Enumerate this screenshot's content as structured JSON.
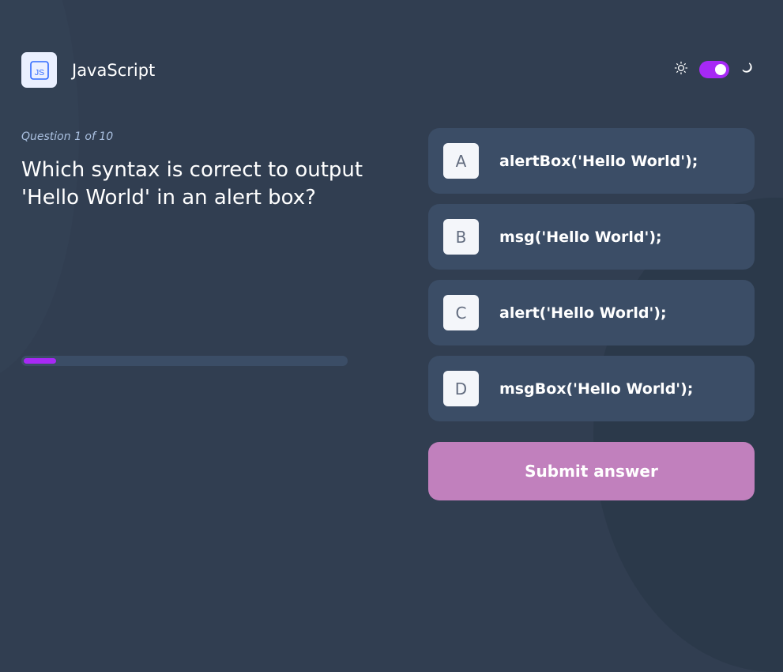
{
  "header": {
    "subject_title": "JavaScript",
    "subject_icon": "js-icon",
    "subject_icon_text": "JS",
    "theme": {
      "light_icon": "sun-icon",
      "dark_icon": "moon-icon",
      "dark_mode_enabled": true
    }
  },
  "question": {
    "meta": "Question 1 of 10",
    "current": 1,
    "total": 10,
    "text": "Which syntax is correct to output 'Hello World' in an alert box?"
  },
  "progress": {
    "fraction": 0.1
  },
  "options": [
    {
      "letter": "A",
      "text": "alertBox('Hello World');"
    },
    {
      "letter": "B",
      "text": "msg('Hello World');"
    },
    {
      "letter": "C",
      "text": "alert('Hello World');"
    },
    {
      "letter": "D",
      "text": "msgBox('Hello World');"
    }
  ],
  "submit": {
    "label": "Submit answer"
  },
  "colors": {
    "background": "#313e51",
    "card": "#3b4d66",
    "accent_purple": "#a729f5",
    "submit_button": "#c180bd",
    "js_icon_blue": "#306aff",
    "muted_text": "#abc1e1"
  }
}
